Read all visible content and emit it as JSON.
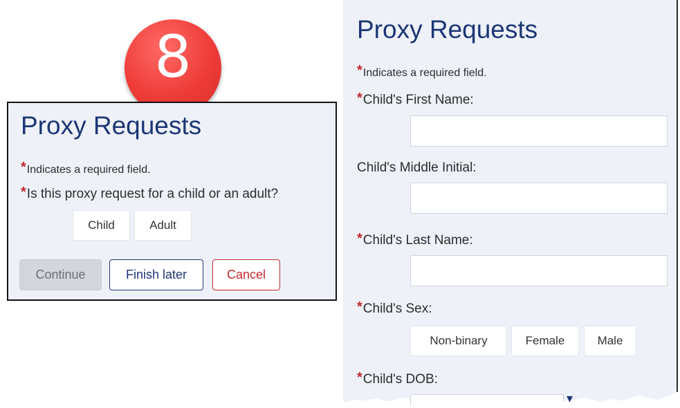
{
  "badge": {
    "number": "8"
  },
  "left_panel": {
    "title": "Proxy Requests",
    "required_note": "Indicates a required field.",
    "question": "Is this proxy request for a child or an adult?",
    "options": [
      "Child",
      "Adult"
    ],
    "buttons": {
      "continue": "Continue",
      "finish_later": "Finish later",
      "cancel": "Cancel"
    },
    "required_marker": "*"
  },
  "right_panel": {
    "title": "Proxy Requests",
    "required_note": "Indicates a required field.",
    "required_marker": "*",
    "fields": {
      "first_name": {
        "label": "Child's First Name:",
        "value": ""
      },
      "middle_initial": {
        "label": "Child's Middle Initial:",
        "value": ""
      },
      "last_name": {
        "label": "Child's Last Name:",
        "value": ""
      }
    },
    "sex": {
      "label": "Child's Sex:",
      "options": [
        "Non-binary",
        "Female",
        "Male"
      ]
    },
    "dob": {
      "label": "Child's DOB:"
    }
  },
  "colors": {
    "accent": "#1c3575",
    "danger": "#c1272d",
    "badge": "#ee3b38",
    "panel_bg": "#eef2f8"
  }
}
